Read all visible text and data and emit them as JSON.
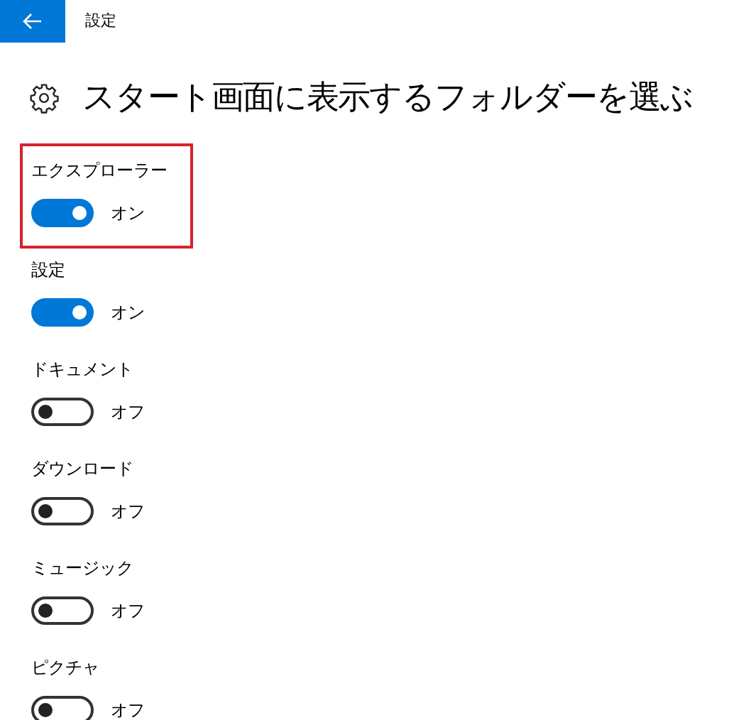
{
  "header": {
    "title": "設定"
  },
  "page": {
    "title": "スタート画面に表示するフォルダーを選ぶ"
  },
  "folders": [
    {
      "label": "エクスプローラー",
      "on": true,
      "state_text": "オン",
      "highlighted": true
    },
    {
      "label": "設定",
      "on": true,
      "state_text": "オン",
      "highlighted": false
    },
    {
      "label": "ドキュメント",
      "on": false,
      "state_text": "オフ",
      "highlighted": false
    },
    {
      "label": "ダウンロード",
      "on": false,
      "state_text": "オフ",
      "highlighted": false
    },
    {
      "label": "ミュージック",
      "on": false,
      "state_text": "オフ",
      "highlighted": false
    },
    {
      "label": "ピクチャ",
      "on": false,
      "state_text": "オフ",
      "highlighted": false
    }
  ]
}
